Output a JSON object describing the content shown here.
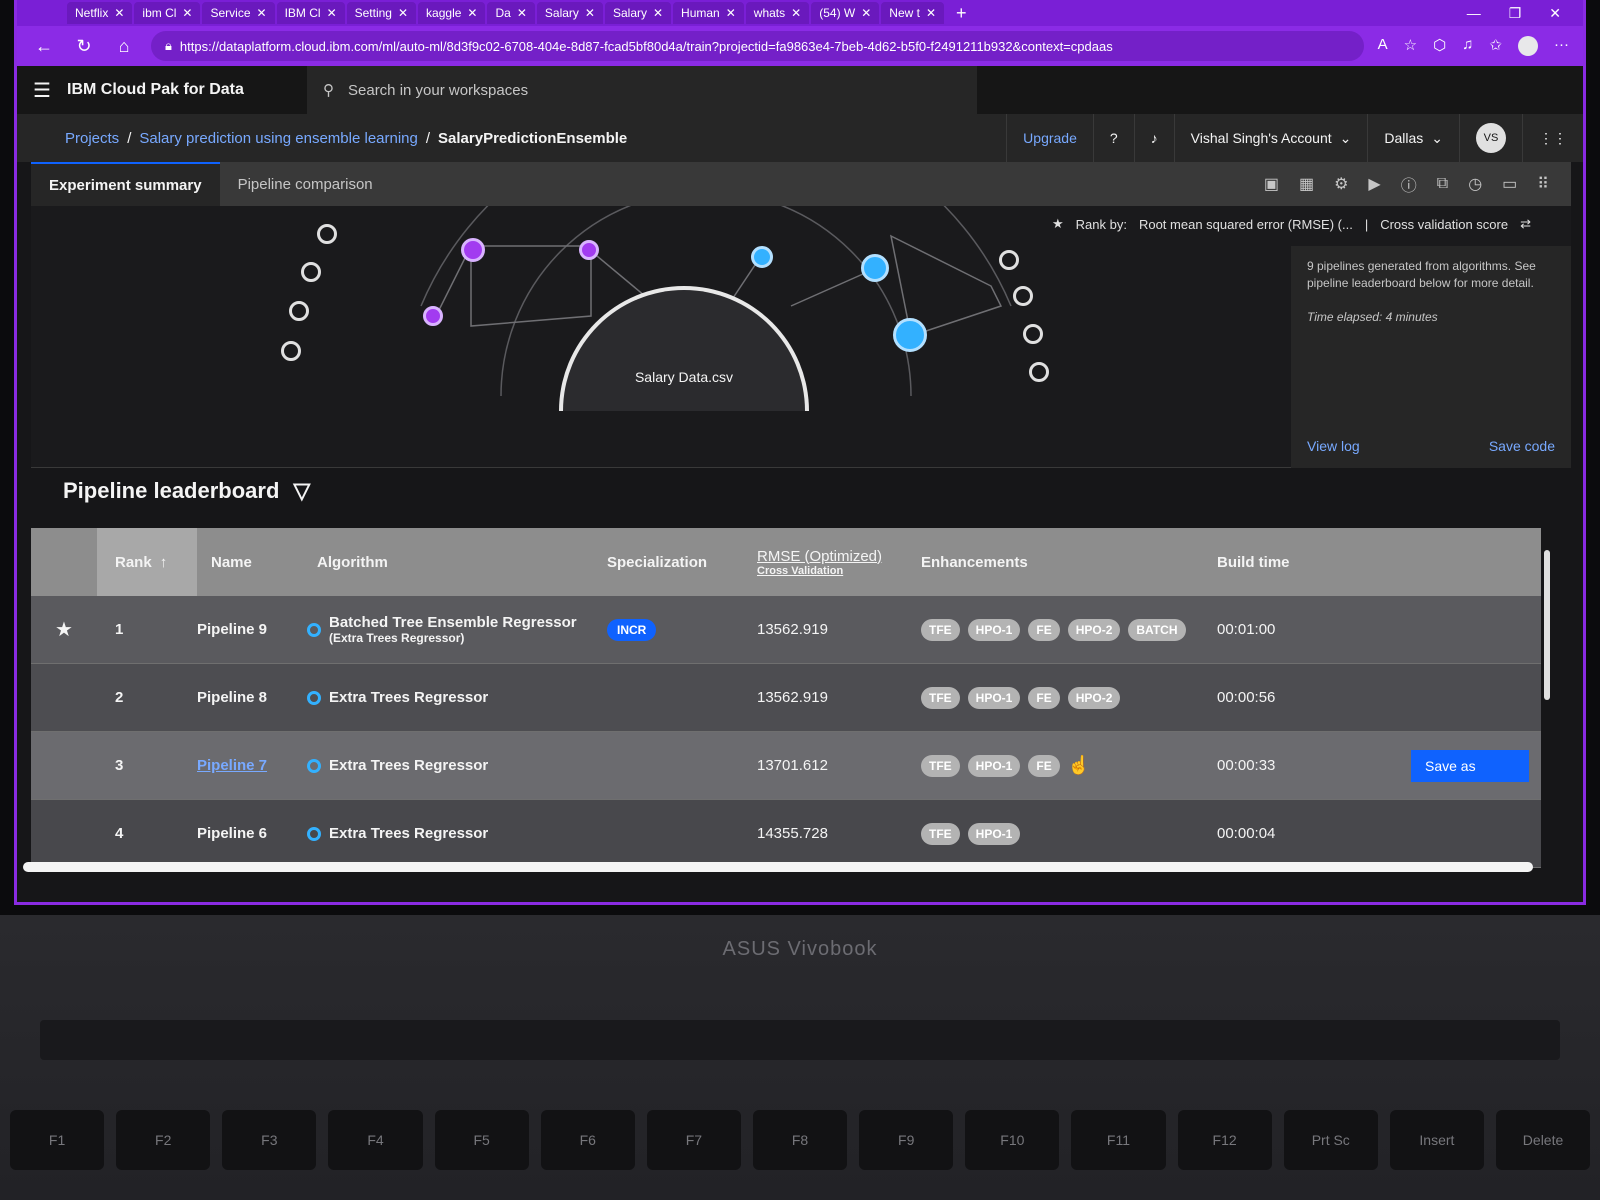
{
  "browser": {
    "tabs": [
      "Netflix",
      "ibm Cl",
      "Service",
      "IBM Cl",
      "Setting",
      "kaggle",
      "Da",
      "Salary",
      "Salary",
      "Human",
      "whats",
      "(54) W",
      "New t"
    ],
    "url": "https://dataplatform.cloud.ibm.com/ml/auto-ml/8d3f9c02-6708-404e-8d87-fcad5bf80d4a/train?projectid=fa9863e4-7beb-4d62-b5f0-f2491211b932&context=cpdaas"
  },
  "app": {
    "product": "IBM Cloud Pak for Data",
    "search_placeholder": "Search in your workspaces",
    "upgrade": "Upgrade",
    "account": "Vishal Singh's Account",
    "region": "Dallas",
    "avatar_initials": "VS"
  },
  "breadcrumb": {
    "projects": "Projects",
    "project": "Salary prediction using ensemble learning",
    "current": "SalaryPredictionEnsemble"
  },
  "subtabs": {
    "summary": "Experiment summary",
    "comparison": "Pipeline comparison"
  },
  "viz": {
    "rank_by_label": "Rank by:",
    "rank_by_value": "Root mean squared error (RMSE) (...",
    "score_type": "Cross validation score",
    "dataset": "Salary Data.csv",
    "note": "9 pipelines generated from algorithms. See pipeline leaderboard below for more detail.",
    "elapsed": "Time elapsed: 4 minutes",
    "view_log": "View log",
    "save_code": "Save code"
  },
  "leaderboard": {
    "title": "Pipeline leaderboard",
    "headers": {
      "rank": "Rank",
      "name": "Name",
      "algorithm": "Algorithm",
      "specialization": "Specialization",
      "rmse": "RMSE (Optimized)",
      "rmse_sub": "Cross Validation",
      "enhancements": "Enhancements",
      "build_time": "Build time"
    },
    "rows": [
      {
        "rank": "1",
        "name": "Pipeline 9",
        "algorithm": "Batched Tree Ensemble Regressor",
        "algorithm_sub": "(Extra Trees Regressor)",
        "specialization": "INCR",
        "rmse": "13562.919",
        "enhancements": [
          "TFE",
          "HPO-1",
          "FE",
          "HPO-2",
          "BATCH"
        ],
        "build_time": "00:01:00"
      },
      {
        "rank": "2",
        "name": "Pipeline 8",
        "algorithm": "Extra Trees Regressor",
        "rmse": "13562.919",
        "enhancements": [
          "TFE",
          "HPO-1",
          "FE",
          "HPO-2"
        ],
        "build_time": "00:00:56"
      },
      {
        "rank": "3",
        "name": "Pipeline 7",
        "algorithm": "Extra Trees Regressor",
        "rmse": "13701.612",
        "enhancements": [
          "TFE",
          "HPO-1",
          "FE"
        ],
        "build_time": "00:00:33",
        "action": "Save as"
      },
      {
        "rank": "4",
        "name": "Pipeline 6",
        "algorithm": "Extra Trees Regressor",
        "rmse": "14355.728",
        "enhancements": [
          "TFE",
          "HPO-1"
        ],
        "build_time": "00:00:04"
      }
    ]
  },
  "device": {
    "brand": "ASUS Vivobook",
    "keys": [
      "F1",
      "F2",
      "F3",
      "F4",
      "F5",
      "F6",
      "F7",
      "F8",
      "F9",
      "F10",
      "F11",
      "F12",
      "Prt Sc",
      "Insert",
      "Delete"
    ]
  }
}
